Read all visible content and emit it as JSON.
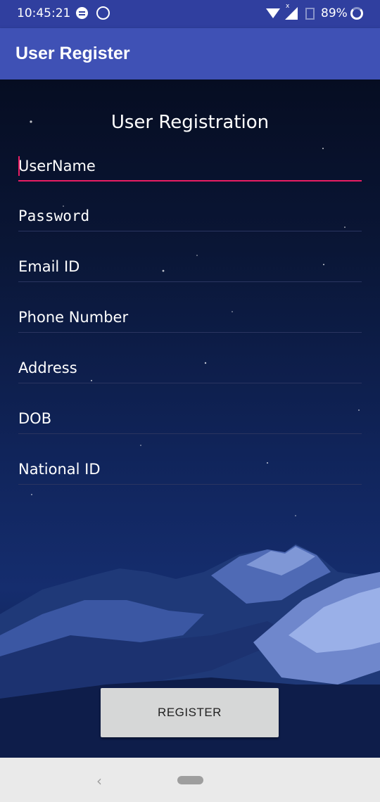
{
  "status_bar": {
    "time": "10:45:21",
    "battery": "89%",
    "icons": [
      "message-notification-icon",
      "whatsapp-notification-icon",
      "wifi-icon",
      "cell-signal-icon",
      "no-sim-icon",
      "battery-ring-icon"
    ]
  },
  "app_bar": {
    "title": "User Register"
  },
  "form": {
    "heading": "User Registration",
    "fields": [
      {
        "hint": "UserName",
        "active": true
      },
      {
        "hint": "Password"
      },
      {
        "hint": "Email ID"
      },
      {
        "hint": "Phone Number"
      },
      {
        "hint": "Address"
      },
      {
        "hint": "DOB"
      },
      {
        "hint": "National ID"
      }
    ],
    "register_label": "REGISTER"
  },
  "colors": {
    "status_bar": "#303f9f",
    "app_bar": "#3f51b5",
    "accent": "#e91e63",
    "button": "#d6d7d7",
    "nav_bar": "#eaeaea"
  },
  "nav_bar": {
    "icons": [
      "back-icon",
      "home-pill-icon"
    ]
  }
}
